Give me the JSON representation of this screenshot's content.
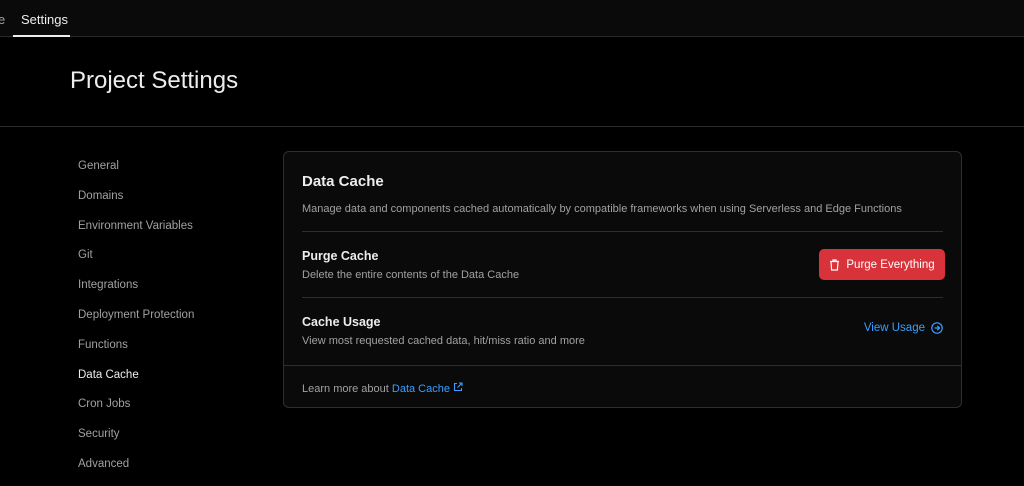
{
  "topbar": {
    "tabs": [
      {
        "label": "e"
      },
      {
        "label": "Settings"
      }
    ]
  },
  "header": {
    "title": "Project Settings"
  },
  "sidebar": {
    "items": [
      {
        "label": "General"
      },
      {
        "label": "Domains"
      },
      {
        "label": "Environment Variables"
      },
      {
        "label": "Git"
      },
      {
        "label": "Integrations"
      },
      {
        "label": "Deployment Protection"
      },
      {
        "label": "Functions"
      },
      {
        "label": "Data Cache"
      },
      {
        "label": "Cron Jobs"
      },
      {
        "label": "Security"
      },
      {
        "label": "Advanced"
      }
    ]
  },
  "card": {
    "title": "Data Cache",
    "description": "Manage data and components cached automatically by compatible frameworks when using Serverless and Edge Functions",
    "purge": {
      "title": "Purge Cache",
      "description": "Delete the entire contents of the Data Cache",
      "button": "Purge Everything"
    },
    "usage": {
      "title": "Cache Usage",
      "description": "View most requested cached data, hit/miss ratio and more",
      "link": "View Usage"
    },
    "footer": {
      "text": "Learn more about ",
      "link": "Data Cache"
    }
  }
}
